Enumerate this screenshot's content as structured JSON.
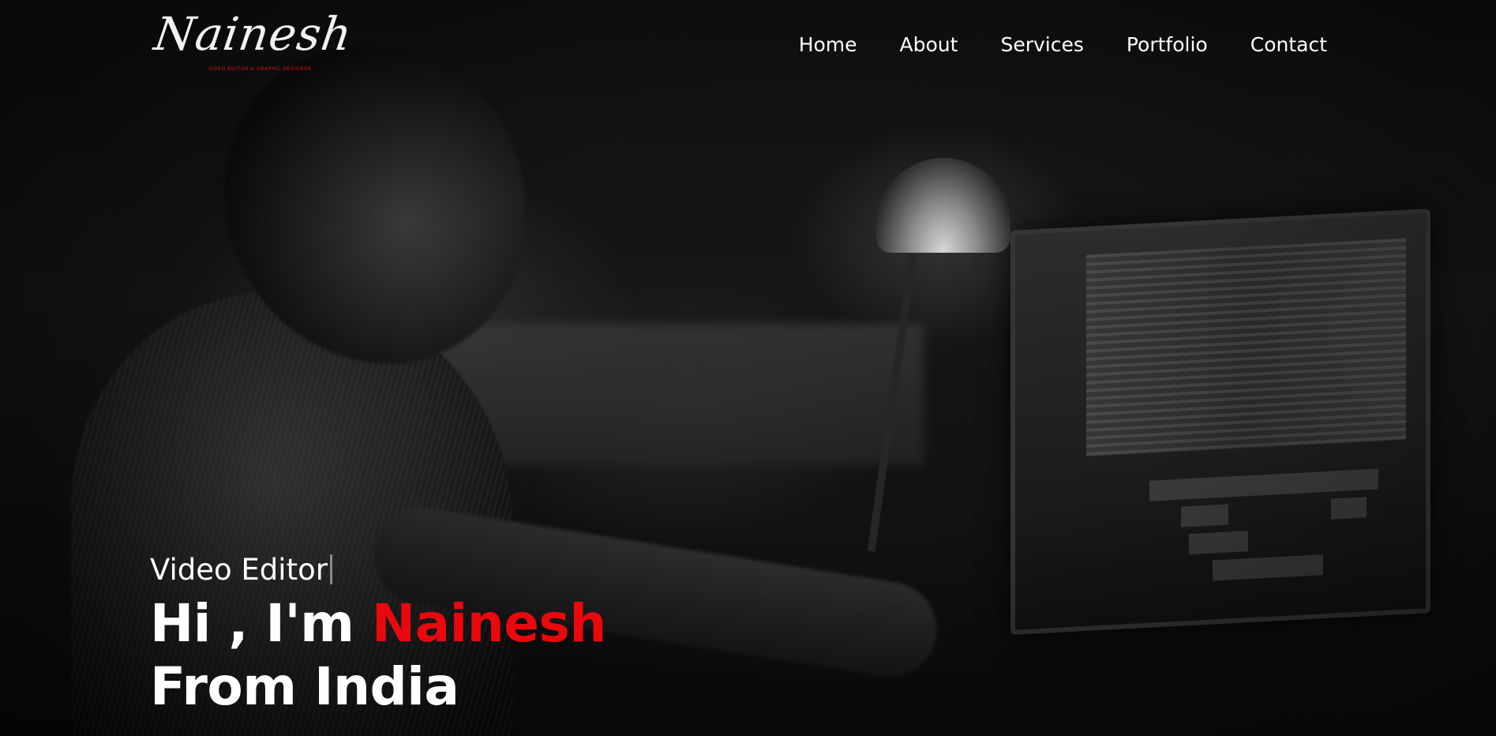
{
  "brand": {
    "logo_text": "Nainesh",
    "tagline": "VIDEO EDITOR & GRAPHIC DESIGNER",
    "accent_color": "#e8080e"
  },
  "nav": {
    "items": [
      {
        "label": "Home"
      },
      {
        "label": "About"
      },
      {
        "label": "Services"
      },
      {
        "label": "Portfolio"
      },
      {
        "label": "Contact"
      }
    ]
  },
  "hero": {
    "role": "Video Editor",
    "greeting": "Hi , I'm",
    "name": "Nainesh",
    "origin": "From India",
    "background": "dark monochrome photo of a video editor working at a desk with a lamp and monitors"
  }
}
